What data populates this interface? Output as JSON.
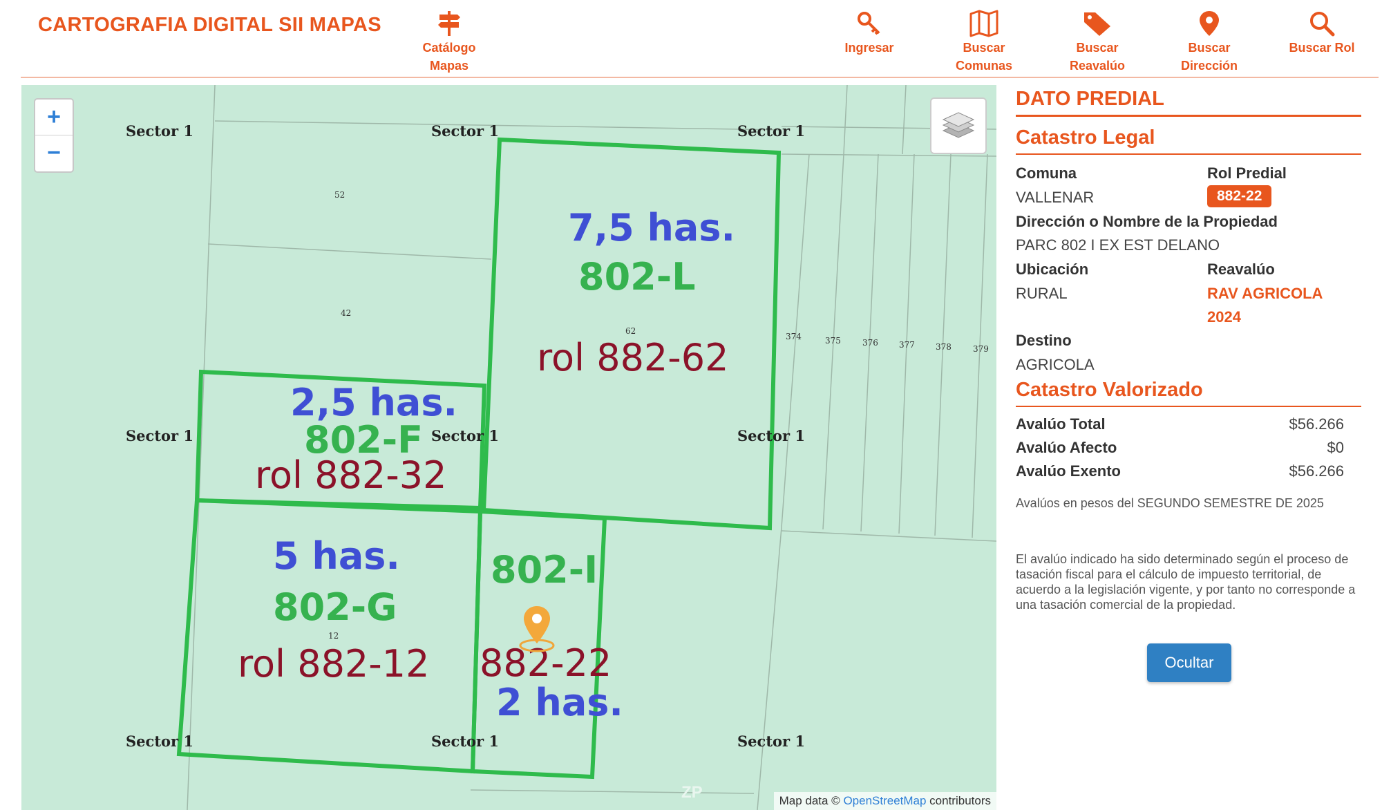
{
  "header": {
    "title": "CARTOGRAFIA DIGITAL SII MAPAS",
    "catalog": {
      "line1": "Catálogo",
      "line2": "Mapas"
    },
    "login": {
      "line1": "Ingresar"
    },
    "communes": {
      "line1": "Buscar",
      "line2": "Comunas"
    },
    "appraisal": {
      "line1": "Buscar",
      "line2": "Reavalúo"
    },
    "address": {
      "line1": "Buscar",
      "line2": "Dirección"
    },
    "rol": {
      "line1": "Buscar Rol"
    }
  },
  "map": {
    "zoom_in": "+",
    "zoom_out": "−",
    "sector_label": "Sector 1",
    "lot_numbers": [
      "52",
      "42",
      "62",
      "12",
      "374",
      "375",
      "376",
      "377",
      "378",
      "379"
    ],
    "parcels": {
      "l": {
        "has": "7,5 has.",
        "code": "802-L",
        "rol": "rol 882-62"
      },
      "f": {
        "has": "2,5 has.",
        "code": "802-F",
        "rol": "rol 882-32"
      },
      "g": {
        "has": "5 has.",
        "code": "802-G",
        "rol": "rol 882-12"
      },
      "i": {
        "code": "802-I",
        "rol": "882-22",
        "has": "2 has."
      }
    },
    "watermark": "ZP",
    "attribution": {
      "prefix": "Map data © ",
      "link": "OpenStreetMap",
      "suffix": " contributors"
    }
  },
  "panel": {
    "title": "DATO PREDIAL",
    "legal_title": "Catastro Legal",
    "comuna_label": "Comuna",
    "comuna_value": "VALLENAR",
    "rol_label": "Rol Predial",
    "rol_value": "882-22",
    "address_label": "Dirección o Nombre de la Propiedad",
    "address_value": "PARC 802 I EX EST DELANO",
    "location_label": "Ubicación",
    "location_value": "RURAL",
    "reavaluo_label": "Reavalúo",
    "reavaluo_line1": "RAV AGRICOLA",
    "reavaluo_line2": "2024",
    "destino_label": "Destino",
    "destino_value": "AGRICOLA",
    "valued_title": "Catastro Valorizado",
    "total_label": "Avalúo Total",
    "total_value": "$56.266",
    "afecto_label": "Avalúo Afecto",
    "afecto_value": "$0",
    "exento_label": "Avalúo Exento",
    "exento_value": "$56.266",
    "note1": "Avalúos en pesos del SEGUNDO SEMESTRE DE 2025",
    "note2": "El avalúo indicado ha sido determinado según el proceso de tasación fiscal para el cálculo de impuesto territorial, de acuerdo a la legislación vigente, y por tanto no corresponde a una tasación comercial de la propiedad.",
    "hide_button": "Ocultar"
  },
  "colors": {
    "accent": "#e8561e",
    "map_bg": "#c8ead8",
    "parcel_outline": "#2fbb4c",
    "has_text": "#3f4fd4",
    "code_text": "#36b24f",
    "rol_text": "#8b1229",
    "button_blue": "#2f80c3"
  }
}
